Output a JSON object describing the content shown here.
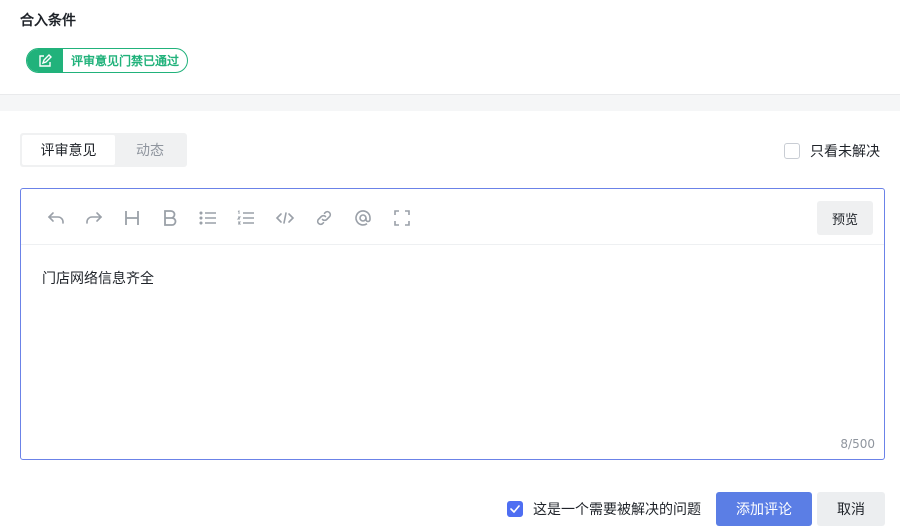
{
  "merge_conditions": {
    "title": "合入条件",
    "badge_text": "评审意见门禁已通过",
    "badge_icon": "edit-check-icon",
    "badge_color": "#21b27b"
  },
  "tabs": [
    {
      "label": "评审意见",
      "active": true
    },
    {
      "label": "动态",
      "active": false
    }
  ],
  "filter": {
    "only_unresolved_label": "只看未解决",
    "checked": false
  },
  "editor": {
    "toolbar_icons": [
      "undo-icon",
      "redo-icon",
      "heading-icon",
      "bold-icon",
      "bullet-list-icon",
      "numbered-list-icon",
      "code-icon",
      "link-icon",
      "mention-icon",
      "fullscreen-icon"
    ],
    "preview_label": "预览",
    "content": "门店网络信息齐全",
    "char_count": "8/500",
    "border_color": "#6b82e8"
  },
  "footer": {
    "issue_checkbox_label": "这是一个需要被解决的问题",
    "issue_checked": true,
    "add_comment_label": "添加评论",
    "cancel_label": "取消",
    "primary_color": "#5b7ee5"
  }
}
